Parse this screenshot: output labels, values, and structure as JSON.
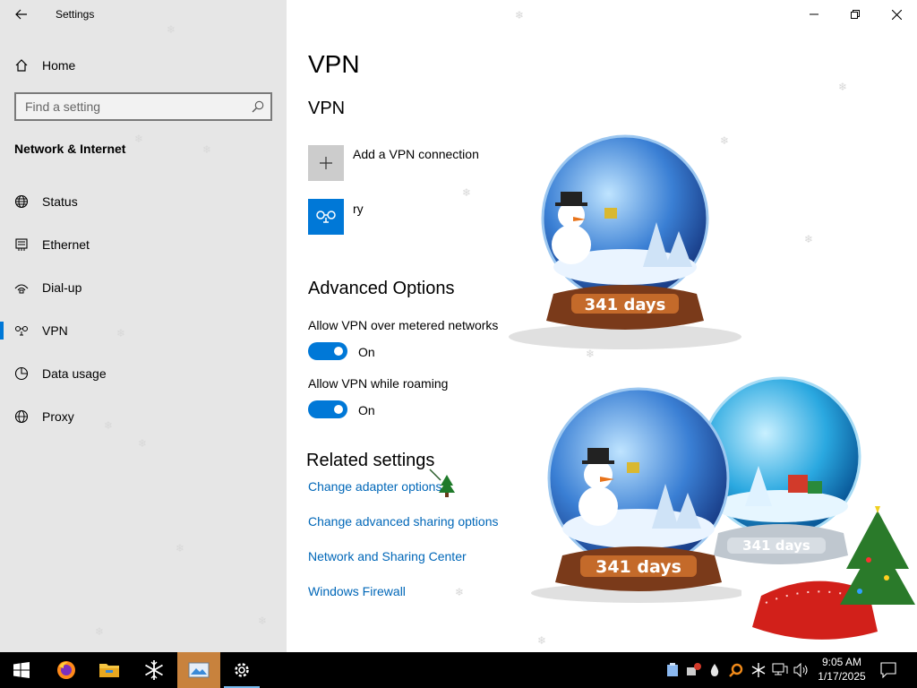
{
  "app": {
    "title": "Settings"
  },
  "sidebar": {
    "home_label": "Home",
    "search_placeholder": "Find a setting",
    "section_title": "Network & Internet",
    "items": [
      {
        "label": "Status",
        "icon": "globe-icon"
      },
      {
        "label": "Ethernet",
        "icon": "ethernet-icon"
      },
      {
        "label": "Dial-up",
        "icon": "dialup-icon"
      },
      {
        "label": "VPN",
        "icon": "vpn-icon",
        "active": true
      },
      {
        "label": "Data usage",
        "icon": "data-usage-icon"
      },
      {
        "label": "Proxy",
        "icon": "proxy-globe-icon"
      }
    ]
  },
  "main": {
    "page_title": "VPN",
    "vpn_heading": "VPN",
    "add_vpn_label": "Add a VPN connection",
    "connection_name": "ry",
    "advanced_heading": "Advanced Options",
    "metered": {
      "label": "Allow VPN over metered networks",
      "state": "On"
    },
    "roaming": {
      "label": "Allow VPN while roaming",
      "state": "On"
    },
    "related_heading": "Related settings",
    "links": [
      "Change adapter options",
      "Change advanced sharing options",
      "Network and Sharing Center",
      "Windows Firewall"
    ]
  },
  "decorations": {
    "globe_text_1": "341 days",
    "globe_text_2": "341 days",
    "globe_text_3": "341 days"
  },
  "taskbar": {
    "apps": [
      "start-icon",
      "firefox-icon",
      "file-explorer-icon",
      "snowflake-app-icon",
      "image-viewer-icon",
      "settings-gear-icon"
    ],
    "clock_time": "9:05 AM",
    "clock_date": "1/17/2025"
  },
  "colors": {
    "accent": "#0078d7",
    "link": "#0067b8",
    "sidebar_bg": "#e6e6e6",
    "taskbar_bg": "#000000"
  }
}
